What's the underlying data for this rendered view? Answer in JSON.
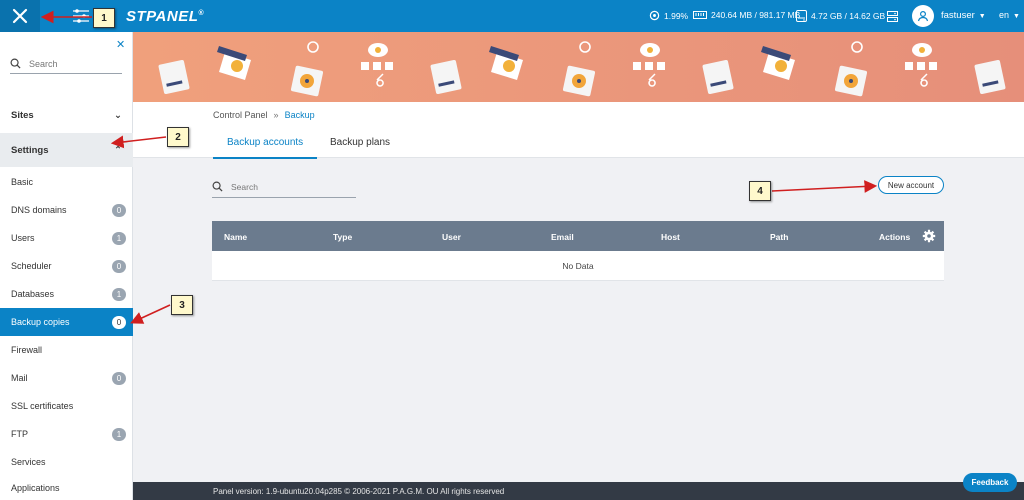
{
  "topbar": {
    "brand": "STPANEL",
    "brand_mark": "®",
    "cpu": "1.99%",
    "memory": "240.64 MB / 981.17 MB",
    "disk": "4.72 GB / 14.62 GB",
    "username": "fastuser",
    "lang": "en"
  },
  "sidebar": {
    "search_placeholder": "Search",
    "sections": [
      {
        "label": "Sites"
      },
      {
        "label": "Settings"
      }
    ],
    "items": [
      {
        "label": "Basic",
        "badge": ""
      },
      {
        "label": "DNS domains",
        "badge": "0"
      },
      {
        "label": "Users",
        "badge": "1"
      },
      {
        "label": "Scheduler",
        "badge": "0"
      },
      {
        "label": "Databases",
        "badge": "1"
      },
      {
        "label": "Backup copies",
        "badge": "0",
        "active": true
      },
      {
        "label": "Firewall",
        "badge": ""
      },
      {
        "label": "Mail",
        "badge": "0"
      },
      {
        "label": "SSL certificates",
        "badge": ""
      },
      {
        "label": "FTP",
        "badge": "1"
      },
      {
        "label": "Services",
        "badge": ""
      },
      {
        "label": "Applications",
        "badge": ""
      }
    ]
  },
  "breadcrumb": {
    "root": "Control Panel",
    "sep": "»",
    "current": "Backup"
  },
  "tabs": [
    {
      "label": "Backup accounts",
      "active": true
    },
    {
      "label": "Backup plans",
      "active": false
    }
  ],
  "main": {
    "search_placeholder": "Search",
    "new_account_label": "New account",
    "columns": [
      "Name",
      "Type",
      "User",
      "Email",
      "Host",
      "Path",
      "Actions"
    ],
    "empty_text": "No Data"
  },
  "footer": {
    "text": "Panel version: 1.9-ubuntu20.04p285 © 2006-2021 P.A.G.M. OU All rights reserved"
  },
  "feedback_label": "Feedback",
  "annotations": [
    "1",
    "2",
    "3",
    "4"
  ],
  "colors": {
    "accent": "#0b83c6",
    "banner": "#e8957b",
    "table_header": "#6b7b8e",
    "footer": "#333a45",
    "annotation_arrow": "#d01f1f"
  }
}
